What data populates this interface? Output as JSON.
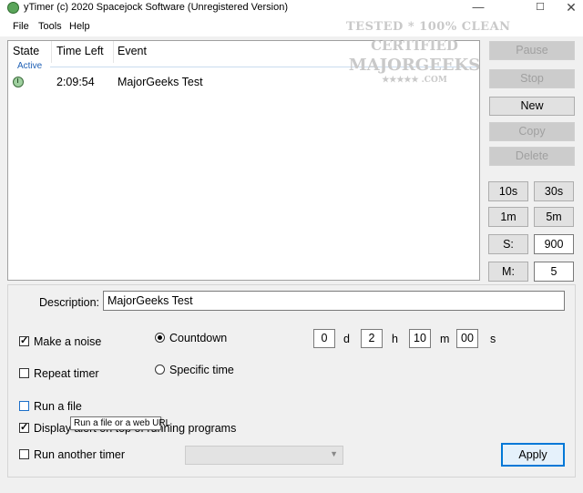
{
  "window": {
    "title": "yTimer (c) 2020 Spacejock Software (Unregistered Version)",
    "minimize": "—",
    "maximize": "☐",
    "close": "✕"
  },
  "menu": [
    "File",
    "Tools",
    "Help"
  ],
  "list": {
    "columns": [
      "State",
      "Time Left",
      "Event"
    ],
    "group": "Active",
    "rows": [
      {
        "state_icon": "clock-icon",
        "time_left": "2:09:54",
        "event": "MajorGeeks Test"
      }
    ]
  },
  "watermark": {
    "line1": "TESTED * 100% CLEAN",
    "line2": "CERTIFIED",
    "line3": "MAJORGEEKS",
    "line4": "★★★★★ .COM"
  },
  "side_buttons": {
    "pause": "Pause",
    "stop": "Stop",
    "new": "New",
    "copy": "Copy",
    "delete": "Delete"
  },
  "quick": {
    "b10s": "10s",
    "b30s": "30s",
    "b1m": "1m",
    "b5m": "5m",
    "s_label": "S:",
    "s_value": "900",
    "m_label": "M:",
    "m_value": "5"
  },
  "form": {
    "description_label": "Description:",
    "description_value": "MajorGeeks Test",
    "make_noise": {
      "label": "Make a noise",
      "checked": true
    },
    "repeat_timer": {
      "label": "Repeat timer",
      "checked": false
    },
    "run_file": {
      "label": "Run a file",
      "checked": false
    },
    "display_alert": {
      "label": "Display alert on top of running programs",
      "checked": true
    },
    "run_another": {
      "label": "Run another timer",
      "checked": false
    },
    "countdown": {
      "label": "Countdown",
      "selected": true
    },
    "specific_time": {
      "label": "Specific time",
      "selected": false
    },
    "time": {
      "d": "0",
      "d_unit": "d",
      "h": "2",
      "h_unit": "h",
      "m": "10",
      "m_unit": "m",
      "s": "00",
      "s_unit": "s"
    },
    "tooltip": "Run a file or a web URL",
    "apply": "Apply"
  }
}
